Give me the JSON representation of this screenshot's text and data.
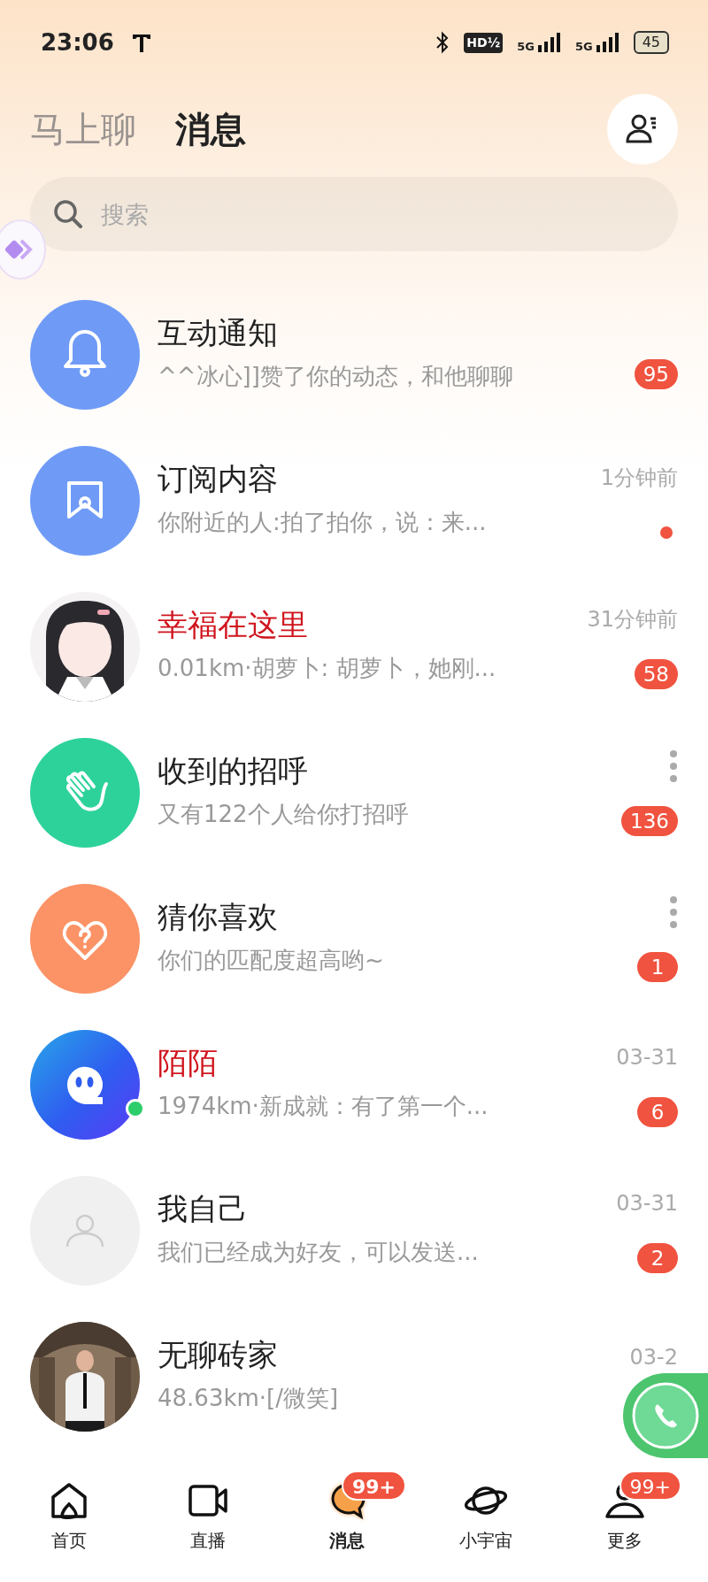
{
  "status_bar": {
    "time": "23:06",
    "hd": "HD½",
    "network_1": "5G",
    "network_2": "5G",
    "battery": "45"
  },
  "header_tabs": [
    {
      "label": "马上聊",
      "selected": false
    },
    {
      "label": "消息",
      "selected": true
    }
  ],
  "search": {
    "placeholder": "搜索"
  },
  "conversations": [
    {
      "kind": "bell",
      "color": "#6f9bf7",
      "name": "互动通知",
      "highlighted": false,
      "preview": "^^冰心]]赞了你的动态，和他聊聊",
      "badge": "95",
      "unread_dot": false,
      "more_menu": false,
      "online": false
    },
    {
      "kind": "bookmark",
      "color": "#6f9bf7",
      "name": "订阅内容",
      "highlighted": false,
      "time": "1分钟前",
      "preview": "你附近的人:拍了拍你，说：来...",
      "unread_dot": true,
      "more_menu": false,
      "online": false
    },
    {
      "kind": "picture",
      "name": "幸福在这里",
      "highlighted": true,
      "time": "31分钟前",
      "preview": "0.01km·胡萝卜: 胡萝卜，她刚...",
      "badge": "58",
      "unread_dot": false,
      "more_menu": false,
      "online": false
    },
    {
      "kind": "hand",
      "color": "#2dd29a",
      "name": "收到的招呼",
      "highlighted": false,
      "preview": "又有122个人给你打招呼",
      "badge": "136",
      "unread_dot": false,
      "more_menu": true,
      "online": false
    },
    {
      "kind": "heart",
      "color": "#fb9366",
      "name": "猜你喜欢",
      "highlighted": false,
      "preview": "你们的匹配度超高哟~",
      "badge": "1",
      "unread_dot": false,
      "more_menu": true,
      "online": false
    },
    {
      "kind": "logo",
      "color": "#2f5cf0",
      "name": "陌陌",
      "highlighted": true,
      "time": "03-31",
      "preview": "1974km·新成就：有了第一个...",
      "badge": "6",
      "unread_dot": false,
      "more_menu": false,
      "online": true
    },
    {
      "kind": "person",
      "color": "#f0f0f0",
      "name": "我自己",
      "highlighted": false,
      "time": "03-31",
      "preview": "我们已经成为好友，可以发送...",
      "badge": "2",
      "unread_dot": false,
      "more_menu": false,
      "online": false
    },
    {
      "kind": "picture",
      "name": "无聊砖家",
      "highlighted": false,
      "time": "03-2",
      "preview": "48.63km·[/微笑]",
      "unread_dot": false,
      "more_menu": false,
      "online": false
    }
  ],
  "bottom_nav": [
    {
      "kind": "home",
      "label": "首页",
      "selected": false
    },
    {
      "kind": "video",
      "label": "直播",
      "selected": false
    },
    {
      "kind": "chat",
      "label": "消息",
      "selected": true,
      "badge": "99+"
    },
    {
      "kind": "planet",
      "label": "小宇宙",
      "selected": false
    },
    {
      "kind": "more",
      "label": "更多",
      "selected": false,
      "badge": "99+"
    }
  ]
}
